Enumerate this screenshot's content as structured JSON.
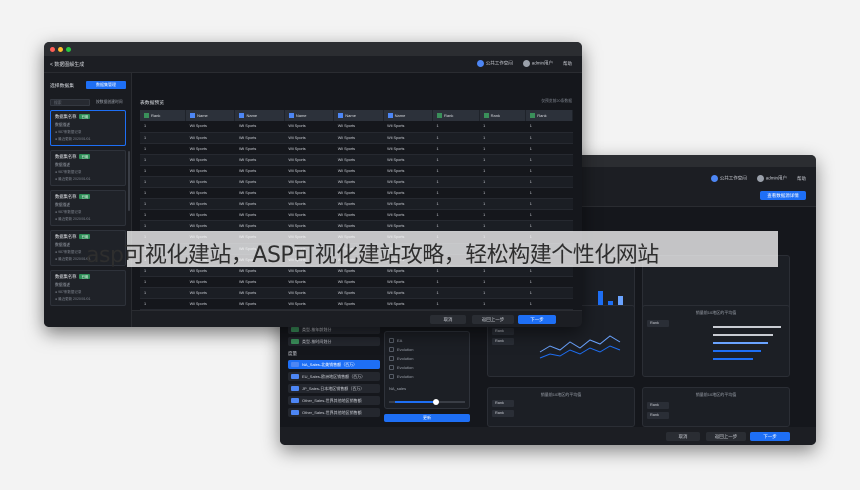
{
  "caption": "asp可视化建站，ASP可视化建站攻略，轻松构建个性化网站",
  "colors": {
    "accent": "#1e6ff5",
    "bg_dark": "#15171c",
    "dimension_tag": "#3a8f5a",
    "measure_tag": "#4d86f4"
  },
  "front_window": {
    "header": {
      "back_label": "< 数据图解生成",
      "workspace": "公共工作空间",
      "user": "admin用户",
      "more": "帮助"
    },
    "sidebar": {
      "title": "选择数据集",
      "manage_button": "数据集管理",
      "search_placeholder": "搜索",
      "filter_label": "按数据创建时间",
      "cards": [
        {
          "name": "数据集名称",
          "badge": "已用",
          "desc": "数据描述",
          "count": "● 987条数据记录",
          "date": "● 最近更新 2020/01/01"
        },
        {
          "name": "数据集名称",
          "badge": "已用",
          "desc": "数据描述",
          "count": "● 987条数据记录",
          "date": "● 最近更新 2020/01/01"
        },
        {
          "name": "数据集名称",
          "badge": "已用",
          "desc": "数据描述",
          "count": "● 987条数据记录",
          "date": "● 最近更新 2020/01/01"
        },
        {
          "name": "数据集名称",
          "badge": "已用",
          "desc": "数据描述",
          "count": "● 987条数据记录",
          "date": "● 最近更新 2020/01/01"
        },
        {
          "name": "数据集名称",
          "badge": "已用",
          "desc": "数据描述",
          "count": "● 987条数据记录",
          "date": "● 最近更新 2020/01/01"
        }
      ]
    },
    "main": {
      "title": "表数据预览",
      "hint": "仅预览前20条数据",
      "columns": [
        "Rank",
        "Name",
        "Name",
        "Name",
        "Name",
        "Name",
        "Rank",
        "Rank",
        "Rank"
      ],
      "row": [
        "1",
        "Wii Sports",
        "Wii Sports",
        "Wii Sports",
        "Wii Sports",
        "Wii Sports",
        "1",
        "1",
        "1"
      ],
      "footer": {
        "cancel": "取消",
        "prev": "返回上一步",
        "next": "下一步"
      }
    }
  },
  "back_window": {
    "header": {
      "workspace": "公共工作空间",
      "user": "admin用户",
      "more": "帮助",
      "action": "查看数据源详情"
    },
    "dimensions": [
      "类型-按年龄划分",
      "类型-按时间划分"
    ],
    "measure_label": "度量",
    "measures": [
      "NA_Sales-北美销售额（百万）",
      "EU_Sales-欧洲地区销售额（百万）",
      "JP_Sales-日本地区销售额（百万）",
      "Other_Sales-世界其他地区销售额",
      "Other_Sales-世界其他地区销售额"
    ],
    "options": [
      "EA",
      "Evolution",
      "Evolution",
      "Evolution",
      "Evolution"
    ],
    "na_sales": "NA_sales",
    "confirm": "更新",
    "panel_title": "销量前10地区的平均值",
    "rank_label": "Rank",
    "footer": {
      "cancel": "取消",
      "prev": "返回上一步",
      "next": "下一步"
    }
  }
}
